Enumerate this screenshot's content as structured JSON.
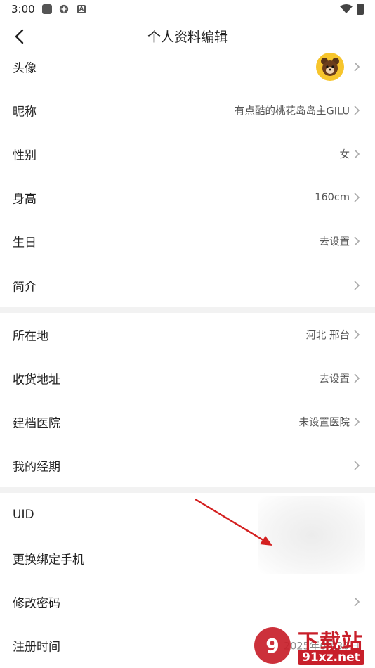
{
  "status_bar": {
    "time": "3:00",
    "notification_icons": [
      "square-app-icon",
      "pinwheel-icon",
      "a-badge-icon"
    ],
    "wifi": "wifi-icon",
    "battery": "battery-charging-icon"
  },
  "header": {
    "title": "个人资料编辑",
    "back_icon": "back-arrow-icon"
  },
  "section1": {
    "avatar_label": "头像",
    "nickname_label": "昵称",
    "nickname_value": "有点酷的桃花岛岛主GILU",
    "gender_label": "性别",
    "gender_value": "女",
    "height_label": "身高",
    "height_value": "160cm",
    "birthday_label": "生日",
    "birthday_value": "去设置",
    "intro_label": "简介"
  },
  "section2": {
    "location_label": "所在地",
    "location_value": "河北 邢台",
    "address_label": "收货地址",
    "address_value": "去设置",
    "hospital_label": "建档医院",
    "hospital_value": "未设置医院",
    "period_label": "我的经期"
  },
  "section3": {
    "uid_label": "UID",
    "phone_label": "更换绑定手机",
    "password_label": "修改密码",
    "register_label": "注册时间",
    "register_value": "2025年6月30日"
  },
  "watermark": {
    "title": "下载站",
    "url": "91xz.net"
  },
  "colors": {
    "accent_arrow": "#d42020",
    "avatar_bg": "#f7c52c",
    "section_gap": "#f2f2f2",
    "watermark_red": "#c81f2a"
  }
}
